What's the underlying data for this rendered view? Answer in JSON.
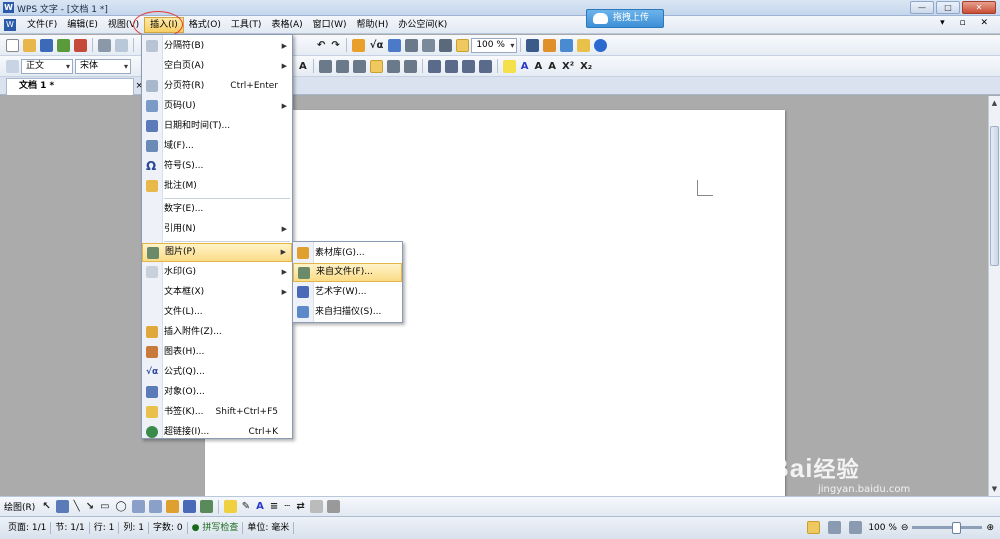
{
  "window": {
    "title": "WPS 文字 - [文档 1 *]",
    "upload_label": "拖拽上传"
  },
  "menubar": {
    "items": [
      "文件(F)",
      "编辑(E)",
      "视图(V)",
      "插入(I)",
      "格式(O)",
      "工具(T)",
      "表格(A)",
      "窗口(W)",
      "帮助(H)",
      "办公空间(K)"
    ],
    "active_index": 3
  },
  "toolbar": {
    "zoom": "100 %",
    "style": "正文",
    "font": "宋体"
  },
  "tabs": {
    "doc_tab": "文档 1 *",
    "close": "×"
  },
  "insert_menu": {
    "items": [
      {
        "label": "分隔符(B)",
        "submenu": true
      },
      {
        "label": "空白页(A)",
        "submenu": true
      },
      {
        "label": "分页符(R)",
        "shortcut": "Ctrl+Enter"
      },
      {
        "label": "页码(U)",
        "submenu": true
      },
      {
        "label": "日期和时间(T)..."
      },
      {
        "label": "域(F)..."
      },
      {
        "label": "符号(S)..."
      },
      {
        "label": "批注(M)"
      },
      {
        "label": "数字(E)..."
      },
      {
        "label": "引用(N)",
        "submenu": true
      },
      {
        "label": "图片(P)",
        "submenu": true,
        "highlighted": true
      },
      {
        "label": "水印(G)",
        "submenu": true
      },
      {
        "label": "文本框(X)",
        "submenu": true
      },
      {
        "label": "文件(L)..."
      },
      {
        "label": "插入附件(Z)..."
      },
      {
        "label": "图表(H)..."
      },
      {
        "label": "公式(Q)..."
      },
      {
        "label": "对象(O)..."
      },
      {
        "label": "书签(K)...",
        "shortcut": "Shift+Ctrl+F5"
      },
      {
        "label": "超链接(I)...",
        "shortcut": "Ctrl+K"
      }
    ]
  },
  "picture_submenu": {
    "items": [
      {
        "label": "素材库(G)..."
      },
      {
        "label": "来自文件(F)...",
        "highlighted": true
      },
      {
        "label": "艺术字(W)..."
      },
      {
        "label": "来自扫描仪(S)..."
      }
    ]
  },
  "drawbar": {
    "label": "绘图(R)"
  },
  "statusbar": {
    "page": "页面: 1/1",
    "section": "节: 1/1",
    "line": "行: 1",
    "column": "列: 1",
    "words": "字数: 0",
    "spell": "拼写检查",
    "unit": "单位: 毫米",
    "zoom": "100 %"
  },
  "watermark": {
    "brand": "Bai",
    "brand_cn": "经验",
    "url": "jingyan.baidu.com"
  },
  "colors": {
    "highlight": "#fbdc87",
    "circle": "#e23a3a",
    "upload": "#3d8fd6"
  }
}
